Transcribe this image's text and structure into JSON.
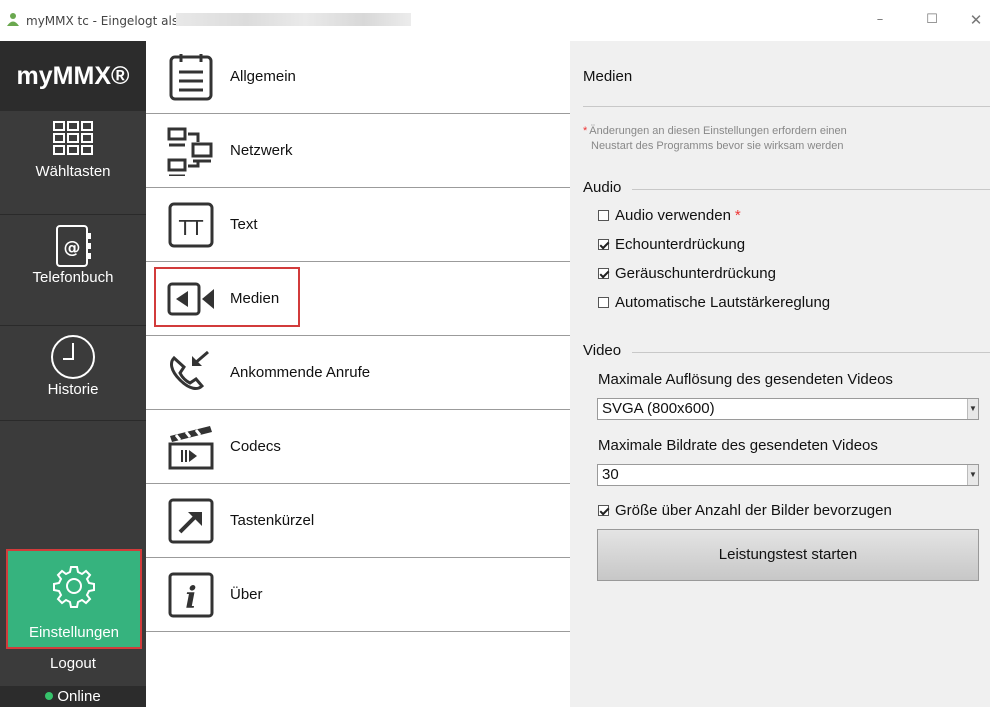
{
  "window": {
    "title": "myMMX tc - Eingelogt als",
    "minimize_glyph": "–",
    "maximize_glyph": "☐",
    "close_glyph": "✕"
  },
  "sidebar": {
    "logo": "myMMX®",
    "items": [
      {
        "label": "Wähltasten",
        "icon": "dialpad-icon"
      },
      {
        "label": "Telefonbuch",
        "icon": "address-book-icon"
      },
      {
        "label": "Historie",
        "icon": "clock-icon"
      }
    ],
    "settings": {
      "label": "Einstellungen",
      "icon": "gear-icon"
    },
    "logout": "Logout",
    "status": "Online"
  },
  "menu": {
    "items": [
      {
        "label": "Allgemein",
        "icon": "notepad-icon"
      },
      {
        "label": "Netzwerk",
        "icon": "network-icon"
      },
      {
        "label": "Text",
        "icon": "text-icon"
      },
      {
        "label": "Medien",
        "icon": "camera-icon"
      },
      {
        "label": "Ankommende Anrufe",
        "icon": "incoming-call-icon"
      },
      {
        "label": "Codecs",
        "icon": "clapperboard-icon"
      },
      {
        "label": "Tastenkürzel",
        "icon": "shortcut-arrow-icon"
      },
      {
        "label": "Über",
        "icon": "info-icon"
      }
    ],
    "selected": "Medien"
  },
  "panel": {
    "title": "Medien",
    "note_line1": "Änderungen an diesen Einstellungen erfordern einen",
    "note_line2": "Neustart des Programms bevor sie wirksam werden",
    "audio": {
      "heading": "Audio",
      "options": [
        {
          "label": "Audio verwenden",
          "checked": false,
          "required": true
        },
        {
          "label": "Echounterdrückung",
          "checked": true
        },
        {
          "label": "Geräuschunterdrückung",
          "checked": true
        },
        {
          "label": "Automatische Lautstärkereglung",
          "checked": false
        }
      ]
    },
    "video": {
      "heading": "Video",
      "resolution_label": "Maximale Auflösung des gesendeten Videos",
      "resolution_value": "SVGA (800x600)",
      "framerate_label": "Maximale Bildrate des gesendeten Videos",
      "framerate_value": "30",
      "prefer_size_label": "Größe über Anzahl der Bilder bevorzugen",
      "prefer_size_checked": true,
      "test_button": "Leistungstest starten"
    }
  },
  "colors": {
    "sidebar_bg": "#3b3b3b",
    "active_green": "#36b37e",
    "highlight_red": "#d23b3b",
    "online_dot": "#36c26b",
    "panel_bg": "#f0f0f0"
  }
}
